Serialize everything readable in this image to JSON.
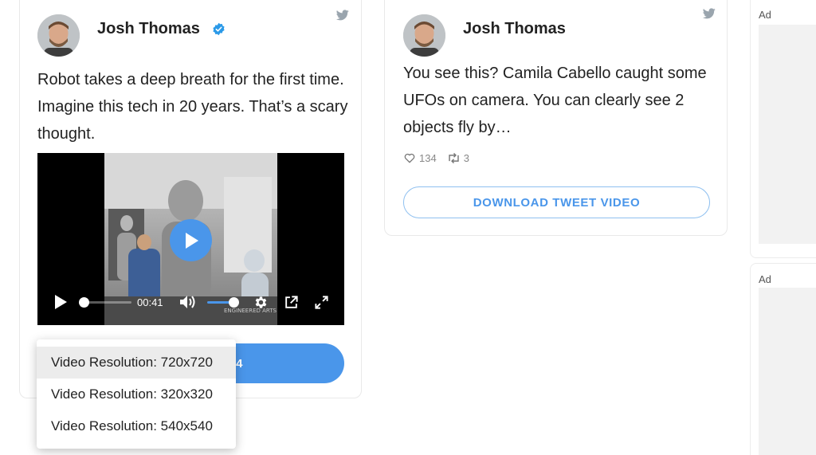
{
  "card1": {
    "author": "Josh Thomas",
    "verified_icon": "verified-badge-icon",
    "source_icon": "twitter-bird-icon",
    "text": "Robot takes a deep breath for the first time. Imagine this tech in 20 years. That’s a scary thought.",
    "video": {
      "time": "00:41",
      "progress": 0.0,
      "volume": 0.8,
      "watermark": "ENGINEERED ARTS",
      "icons": [
        "play-icon",
        "volume-icon",
        "settings-icon",
        "popout-icon",
        "fullscreen-icon"
      ]
    },
    "download_button": "DOWNLOAD MP4",
    "resolution_menu": [
      "Video Resolution: 720x720",
      "Video Resolution: 320x320",
      "Video Resolution: 540x540"
    ],
    "selected_resolution_index": 0
  },
  "card2": {
    "author": "Josh Thomas",
    "source_icon": "twitter-bird-icon",
    "text": "You see this? Camila Cabello caught some UFOs on camera. You can clearly see 2 objects fly by…",
    "likes": "134",
    "retweets": "3",
    "download_button": "DOWNLOAD TWEET VIDEO"
  },
  "ads": [
    "Ad",
    "Ad"
  ],
  "colors": {
    "accent": "#4a96ea",
    "text": "#222222",
    "muted": "#888888",
    "border": "#e9e9e9"
  }
}
